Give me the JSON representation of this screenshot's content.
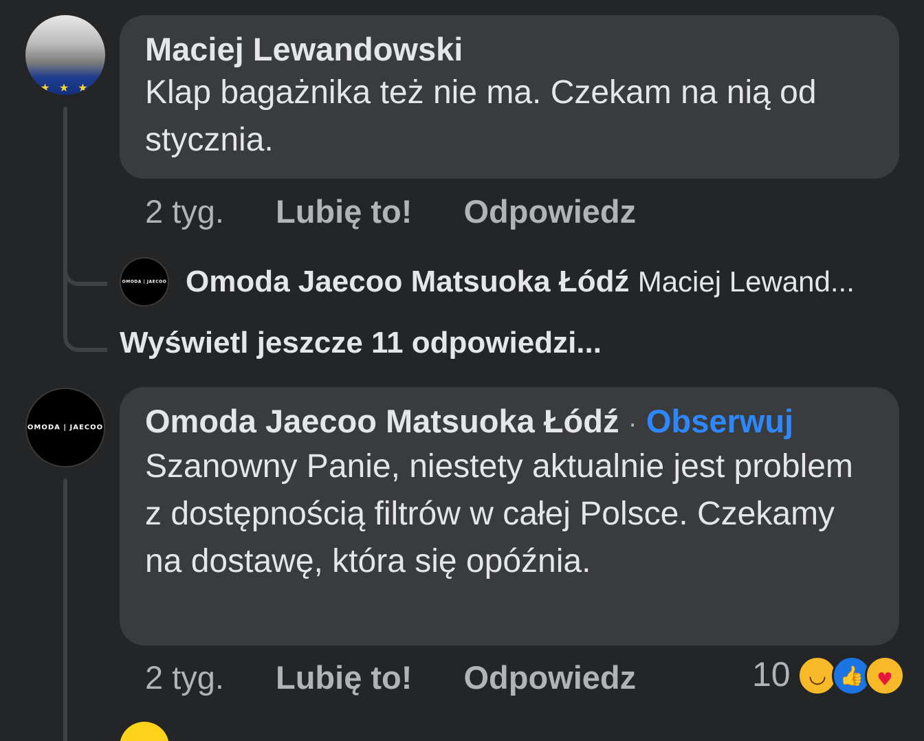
{
  "comments": [
    {
      "author": "Maciej Lewandowski",
      "text": "Klap bagażnika też nie ma. Czekam na nią od stycznia.",
      "time": "2 tyg.",
      "like_label": "Lubię to!",
      "reply_label": "Odpowiedz"
    },
    {
      "author": "Omoda Jaecoo Matsuoka Łódź",
      "separator": "·",
      "follow_label": "Obserwuj",
      "text": "Szanowny Panie, niestety aktualnie jest problem z dostępnością filtrów w całej Polsce. Czekamy na dostawę, która się opóźnia.",
      "time": "2 tyg.",
      "like_label": "Lubię to!",
      "reply_label": "Odpowiedz",
      "reaction_count": "10",
      "reactions": [
        "haha-icon",
        "like-icon",
        "care-icon"
      ]
    }
  ],
  "reply_preview": {
    "author": "Omoda Jaecoo Matsuoka Łódź",
    "preview": "Maciej Lewand..."
  },
  "more_replies_label": "Wyświetl jeszcze 11 odpowiedzi...",
  "avatar_logo_text": "OMODA | JAECOO",
  "avatar_logo_text_small": "OMODA | JAECOO",
  "colors": {
    "background": "#242526",
    "bubble": "#3a3b3c",
    "text": "#e4e6eb",
    "secondary_text": "#b0b3b8",
    "link": "#2d88ff"
  }
}
